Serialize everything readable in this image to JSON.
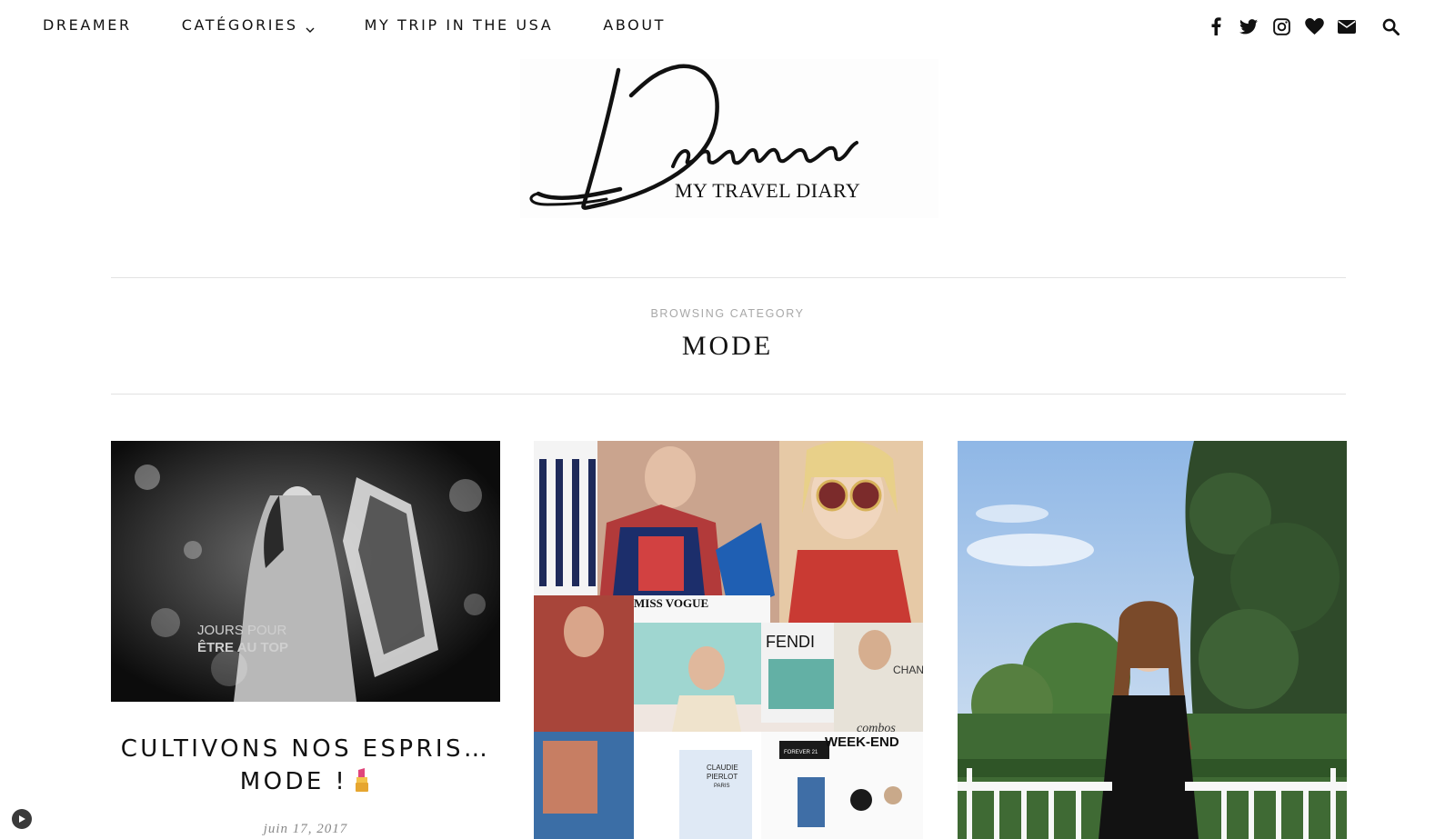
{
  "nav": {
    "items": [
      {
        "label": "DREAMER"
      },
      {
        "label": "CATÉGORIES"
      },
      {
        "label": "MY TRIP IN THE USA"
      },
      {
        "label": "ABOUT"
      }
    ],
    "social_icons": [
      "facebook-icon",
      "twitter-icon",
      "instagram-icon",
      "heart-icon",
      "envelope-icon",
      "search-icon"
    ]
  },
  "logo": {
    "script_text": "Dreamer",
    "tagline": "MY TRAVEL DIARY"
  },
  "category": {
    "kicker": "BROWSING CATEGORY",
    "title": "MODE"
  },
  "posts": [
    {
      "title_line1": "CULTIVONS NOS ESPRIS…",
      "title_line2": "MODE !",
      "emoji": "lipstick",
      "date": "juin 17, 2017",
      "image_text": {
        "line1": "JOURS POUR",
        "line2": "ÊTRE AU TOP"
      }
    },
    {
      "title_line1": "",
      "image_text": {
        "missvogue": "MISS VOGUE",
        "fendi": "FENDI",
        "chan": "CHAN",
        "combos": "combos",
        "weekend": "WEEK-END",
        "forever": "FOREVER 21",
        "claudie1": "CLAUDIE",
        "claudie2": "PIERLOT",
        "claudie3": "PARIS"
      }
    },
    {
      "title_line1": ""
    }
  ],
  "colors": {
    "text": "#111111",
    "muted": "#a8a8a8",
    "rule": "#e2e2e2",
    "date": "#888888"
  }
}
